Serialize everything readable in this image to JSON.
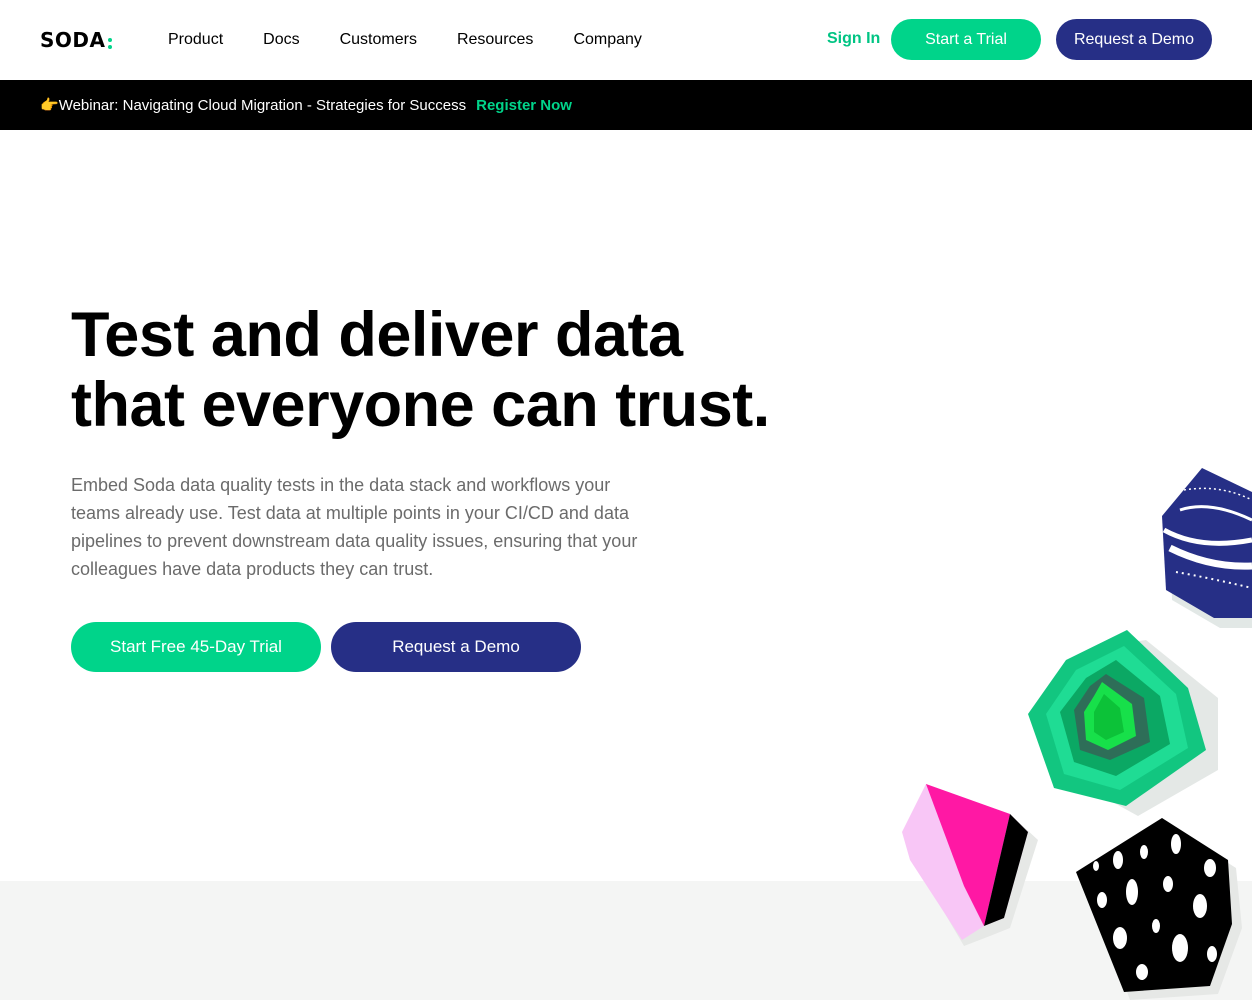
{
  "header": {
    "logo": "SODA",
    "nav": [
      "Product",
      "Docs",
      "Customers",
      "Resources",
      "Company"
    ],
    "sign_in": "Sign In",
    "trial_button": "Start a Trial",
    "demo_button": "Request a Demo"
  },
  "banner": {
    "emoji": "👉",
    "text": "Webinar: Navigating Cloud Migration - Strategies for Success",
    "link": "Register Now"
  },
  "hero": {
    "title_line1": "Test and deliver data",
    "title_line2": "that everyone can trust.",
    "subtitle": "Embed Soda data quality tests in the data stack and workflows your teams already use. Test data at multiple points in your CI/CD and data pipelines to prevent downstream data quality issues, ensuring that your colleagues have data products they can trust.",
    "trial_button": "Start Free 45-Day Trial",
    "demo_button": "Request a Demo"
  },
  "colors": {
    "accent_green": "#00d48a",
    "navy": "#262f86",
    "banner_bg": "#000000"
  }
}
